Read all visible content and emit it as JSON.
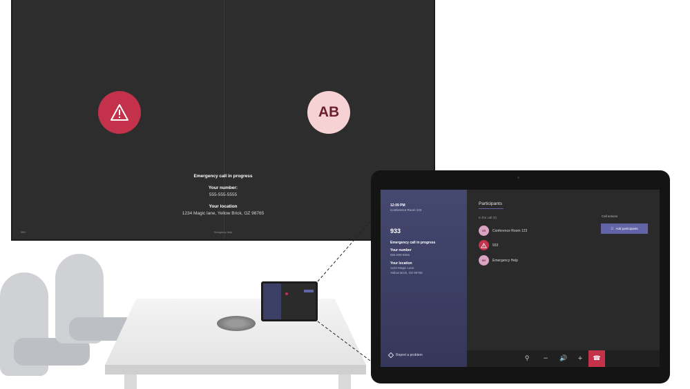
{
  "big_display": {
    "avatar_right_initials": "AB",
    "status_title": "Emergency call in progress",
    "number_label": "Your number:",
    "number_value": "555-555-5555",
    "location_label": "Your location",
    "location_value": "1234 Magic lane, Yellow Brick, OZ 98765",
    "footer_left": "9911",
    "footer_center": "Emergency Help"
  },
  "tablet": {
    "time": "12:09 PM",
    "room": "Conference Room 123",
    "call_number": "933",
    "status": "Emergency call in progress",
    "number_label": "Your number",
    "number_value": "555-555-5555",
    "location_label": "Your location",
    "location_line1": "1234 Magic Lane",
    "location_line2": "Yellow Brick, OZ 98765",
    "report_problem": "Report a problem",
    "participants_title": "Participants",
    "in_call_label": "In the call (3)",
    "call_actions_label": "Call actions",
    "add_participants": "Add participants",
    "participants": [
      {
        "initials": "CR",
        "name": "Conference Room 123",
        "icon": "avatar"
      },
      {
        "initials": "",
        "name": "933",
        "icon": "warning-icon"
      },
      {
        "initials": "EH",
        "name": "Emergency Help",
        "icon": "avatar"
      }
    ],
    "controls": [
      "camera-off-icon",
      "minus-icon",
      "speaker-icon",
      "plus-icon",
      "hang-up-icon"
    ]
  },
  "colors": {
    "accent": "#6264a7",
    "alert_red": "#c4314b",
    "avatar_pink": "#f6d2d4",
    "panel_left": "#45486f"
  }
}
